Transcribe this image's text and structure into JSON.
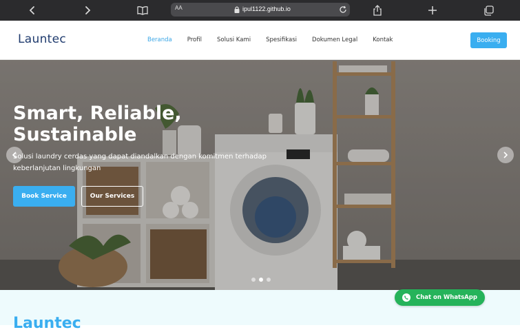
{
  "browser": {
    "url": "ipul1122.github.io",
    "text_size_label": "AA",
    "icons": [
      "chevron-left-icon",
      "chevron-right-icon",
      "book-icon",
      "lock-icon",
      "reload-icon",
      "share-icon",
      "plus-icon",
      "tabs-icon"
    ]
  },
  "nav": {
    "logo": "Launtec",
    "links": [
      "Beranda",
      "Profil",
      "Solusi Kami",
      "Spesifikasi",
      "Dokumen Legal",
      "Kontak"
    ],
    "active_index": 0,
    "booking_label": "Booking"
  },
  "hero": {
    "title": "Smart, Reliable, Sustainable",
    "subtitle": "Solusi laundry cerdas yang dapat diandalkan dengan komitmen terhadap keberlanjutan lingkungan",
    "primary_button": "Book Service",
    "secondary_button": "Our Services",
    "slide_count": 3,
    "active_slide": 2
  },
  "section_below": {
    "title": "Launtec"
  },
  "whatsapp": {
    "label": "Chat on WhatsApp"
  },
  "colors": {
    "accent": "#3aaef0",
    "logo": "#1f3b6e",
    "whatsapp": "#25b35a",
    "browser_chrome": "#2b2b2d"
  }
}
